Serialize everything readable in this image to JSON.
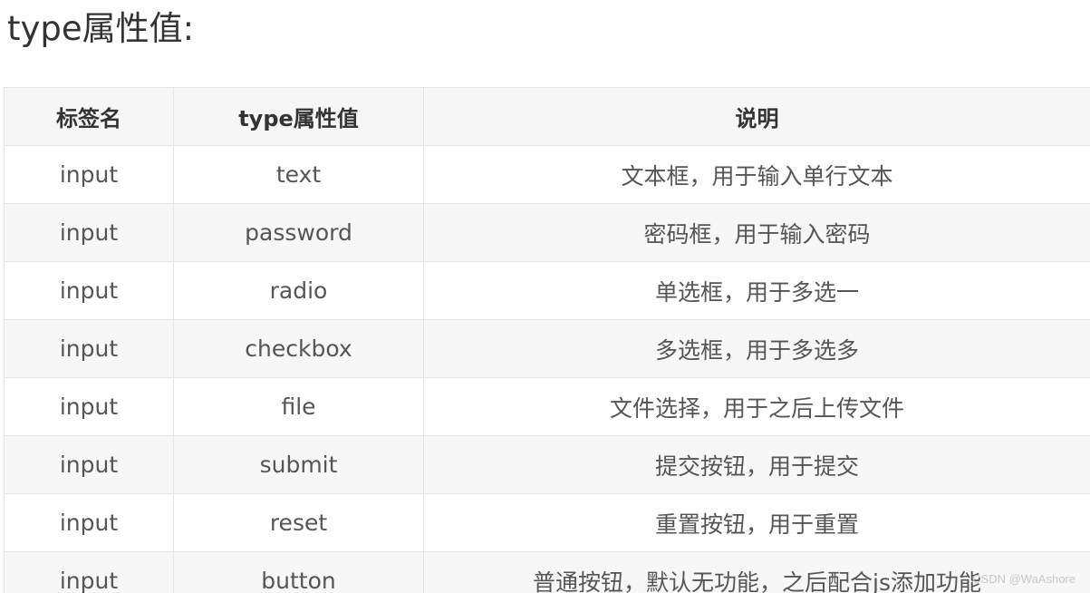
{
  "heading": "type属性值:",
  "table": {
    "headers": [
      "标签名",
      "type属性值",
      "说明"
    ],
    "rows": [
      [
        "input",
        "text",
        "文本框，用于输入单行文本"
      ],
      [
        "input",
        "password",
        "密码框，用于输入密码"
      ],
      [
        "input",
        "radio",
        "单选框，用于多选一"
      ],
      [
        "input",
        "checkbox",
        "多选框，用于多选多"
      ],
      [
        "input",
        "file",
        "文件选择，用于之后上传文件"
      ],
      [
        "input",
        "submit",
        "提交按钮，用于提交"
      ],
      [
        "input",
        "reset",
        "重置按钮，用于重置"
      ],
      [
        "input",
        "button",
        "普通按钮，默认无功能，之后配合js添加功能"
      ]
    ]
  },
  "watermark": "CSDN @WaAshore"
}
